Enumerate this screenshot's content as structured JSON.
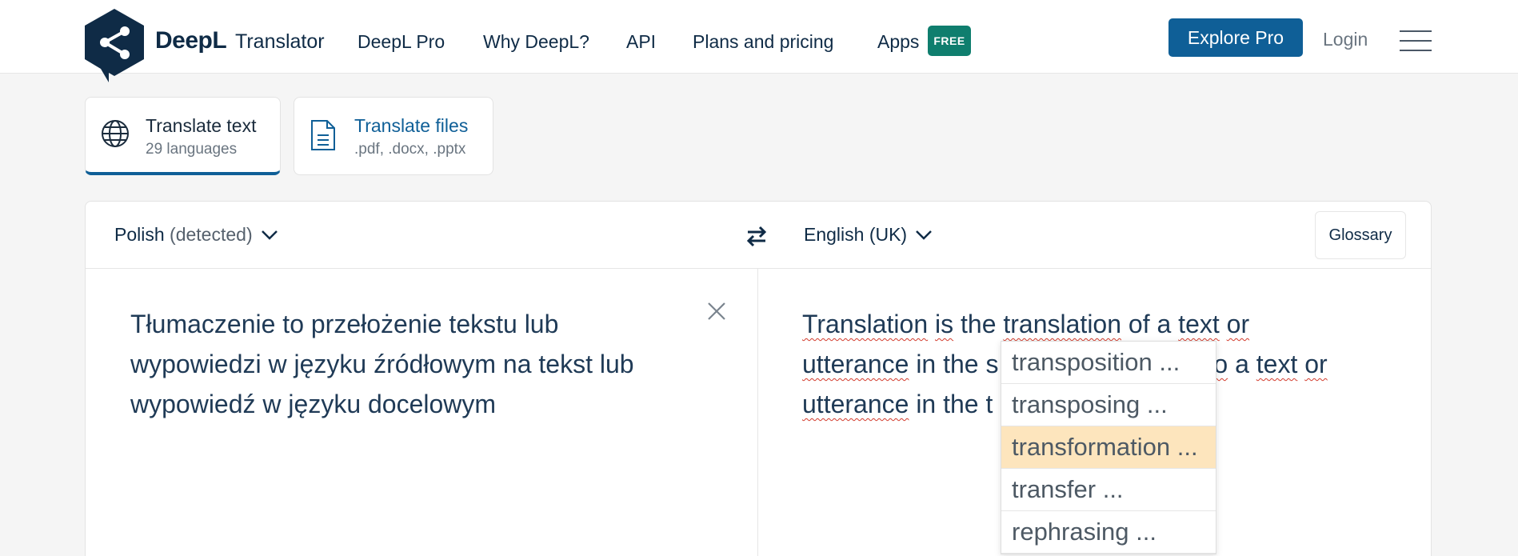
{
  "header": {
    "brand": "DeepL",
    "brand_sub": "Translator",
    "nav": [
      "DeepL Pro",
      "Why DeepL?",
      "API",
      "Plans and pricing",
      "Apps"
    ],
    "free_badge": "FREE",
    "explore_button": "Explore Pro",
    "login": "Login"
  },
  "mode_tabs": [
    {
      "title": "Translate text",
      "subtitle": "29 languages",
      "icon": "globe-icon",
      "active": true
    },
    {
      "title": "Translate files",
      "subtitle": ".pdf, .docx, .pptx",
      "icon": "document-icon",
      "active": false
    }
  ],
  "source": {
    "language": "Polish",
    "detected": "(detected)",
    "text": "Tłumaczenie to przełożenie tekstu lub wypowiedzi w języku źródłowym na tekst lub wypowiedź w języku docelowym"
  },
  "target": {
    "language": "English (UK)",
    "glossary": "Glossary",
    "line1": [
      "Translation",
      " ",
      "is",
      " the ",
      "translation",
      " of a ",
      "text",
      " ",
      "or"
    ],
    "line2_a": "utterance",
    "line2_b": " in the s",
    "line2_c": "to",
    "line2_d": " a ",
    "line2_e": "text",
    "line2_f": " ",
    "line2_g": "or",
    "line3_a": "utterance",
    "line3_b": " in the t"
  },
  "alternatives": [
    "transposition ...",
    "transposing ...",
    "transformation ...",
    "transfer ...",
    "rephrasing ..."
  ],
  "colors": {
    "brand_navy": "#0f2b46",
    "primary_blue": "#0f5f97",
    "badge_green": "#0f7e6e",
    "highlight": "#fde5bd",
    "spell_underline": "#d23b2c"
  }
}
